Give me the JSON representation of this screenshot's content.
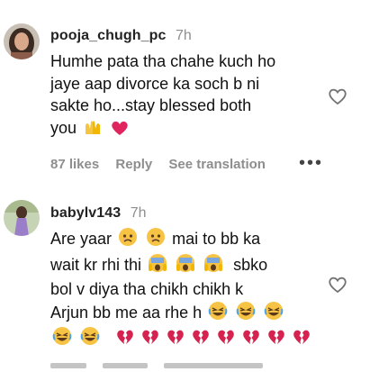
{
  "comments": [
    {
      "username": "pooja_chugh_pc",
      "time": "7h",
      "lines": [
        "Humhe pata tha chahe kuch ho",
        "jaye aap divorce ka soch b ni",
        "sakte ho...stay blessed both",
        "you"
      ],
      "likes": "87 likes",
      "reply": "Reply",
      "see_translation": "See translation",
      "more": "•••"
    },
    {
      "username": "babylv143",
      "time": "7h",
      "lines": [
        "Are yaar",
        "mai to bb ka",
        "wait kr rhi thi",
        "sbko",
        "bol v diya tha chikh chikh k",
        "Arjun bb me aa rhe h"
      ]
    }
  ],
  "icons": {
    "like": "heart-outline-icon",
    "raising_hands": "raising-hands-emoji",
    "pink_heart": "pink-heart-emoji",
    "sad_face": "disappointed-face-emoji",
    "screaming_face": "screaming-face-emoji",
    "laughing_face": "rolling-laughing-emoji",
    "broken_heart": "broken-heart-emoji"
  },
  "colors": {
    "meta_gray": "#8e8e8e",
    "heart_pink": "#e0245e",
    "broken_heart": "#d6224f"
  }
}
